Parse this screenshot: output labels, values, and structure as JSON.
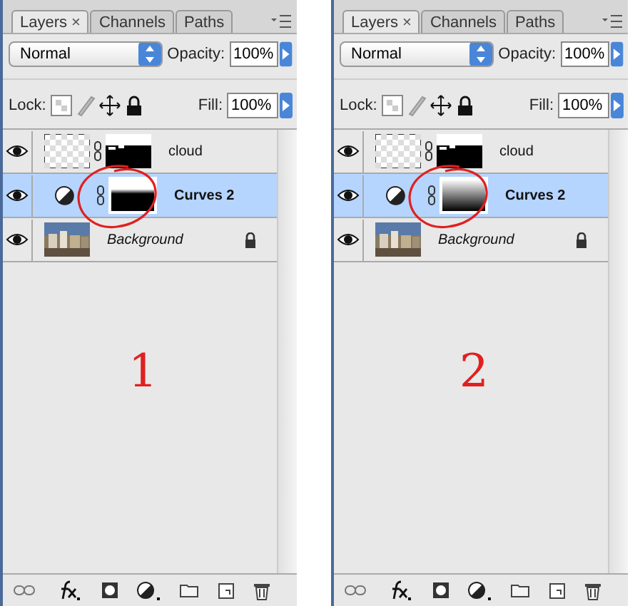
{
  "panels": [
    {
      "tabs": [
        {
          "label": "Layers",
          "close": "×",
          "selected": true
        },
        {
          "label": "Channels",
          "selected": false
        },
        {
          "label": "Paths",
          "selected": false
        }
      ],
      "blend_mode": "Normal",
      "opacity_label": "Opacity:",
      "opacity": "100%",
      "lock_label": "Lock:",
      "fill_label": "Fill:",
      "fill": "100%",
      "layers": [
        {
          "kind": "pixel",
          "name": "cloud",
          "visible": true,
          "selected": false
        },
        {
          "kind": "adjustment",
          "name": "Curves 2",
          "visible": true,
          "selected": true,
          "mask": {
            "kind": "hard"
          },
          "circled": true
        },
        {
          "kind": "background",
          "name": "Background",
          "visible": true,
          "selected": false,
          "locked": true
        }
      ],
      "annotation": "1"
    },
    {
      "tabs": [
        {
          "label": "Layers",
          "close": "×",
          "selected": true
        },
        {
          "label": "Channels",
          "selected": false
        },
        {
          "label": "Paths",
          "selected": false
        }
      ],
      "blend_mode": "Normal",
      "opacity_label": "Opacity:",
      "opacity": "100%",
      "lock_label": "Lock:",
      "fill_label": "Fill:",
      "fill": "100%",
      "layers": [
        {
          "kind": "pixel",
          "name": "cloud",
          "visible": true,
          "selected": false
        },
        {
          "kind": "adjustment",
          "name": "Curves 2",
          "visible": true,
          "selected": true,
          "mask": {
            "kind": "gradient"
          },
          "circled": true
        },
        {
          "kind": "background",
          "name": "Background",
          "visible": true,
          "selected": false,
          "locked": true
        }
      ],
      "annotation": "2"
    }
  ]
}
